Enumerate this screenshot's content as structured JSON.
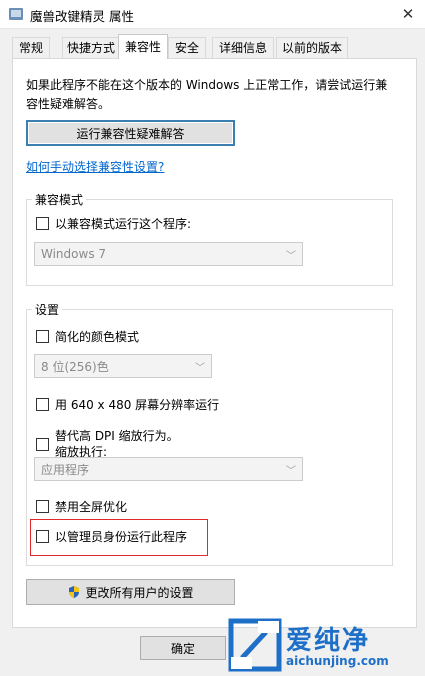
{
  "window": {
    "title": "魔兽改键精灵 属性",
    "close_glyph": "✕"
  },
  "tabs": [
    {
      "label": "常规"
    },
    {
      "label": "快捷方式"
    },
    {
      "label": "兼容性",
      "active": true
    },
    {
      "label": "安全"
    },
    {
      "label": "详细信息"
    },
    {
      "label": "以前的版本"
    }
  ],
  "intro": {
    "description": "如果此程序不能在这个版本的 Windows 上正常工作，请尝试运行兼容性疑难解答。",
    "troubleshoot_button": "运行兼容性疑难解答",
    "manual_link": "如何手动选择兼容性设置?"
  },
  "compat_mode": {
    "group_title": "兼容模式",
    "checkbox_label": "以兼容模式运行这个程序:",
    "checked": false,
    "os_select_value": "Windows 7"
  },
  "settings": {
    "group_title": "设置",
    "reduced_color": {
      "label": "简化的颜色模式",
      "checked": false
    },
    "color_select_value": "8 位(256)色",
    "res_640": {
      "label": "用 640 x 480 屏幕分辨率运行",
      "checked": false
    },
    "dpi_override": {
      "label_line1": "替代高 DPI 缩放行为。",
      "label_line2": "缩放执行:",
      "checked": false
    },
    "dpi_select_value": "应用程序",
    "disable_fullscreen": {
      "label": "禁用全屏优化",
      "checked": false
    },
    "run_as_admin": {
      "label": "以管理员身份运行此程序",
      "checked": false
    }
  },
  "all_users_button": "更改所有用户的设置",
  "footer": {
    "ok_button": "确定"
  },
  "watermark": {
    "brand": "爱纯净",
    "url": "aichunjing.com"
  },
  "colors": {
    "link": "#0066cc",
    "highlight": "#e0282e",
    "brand": "#1e6fc8"
  },
  "icons": [
    "app-icon",
    "close-icon",
    "shield-icon",
    "chevron-down-icon",
    "watermark-logo-icon"
  ]
}
